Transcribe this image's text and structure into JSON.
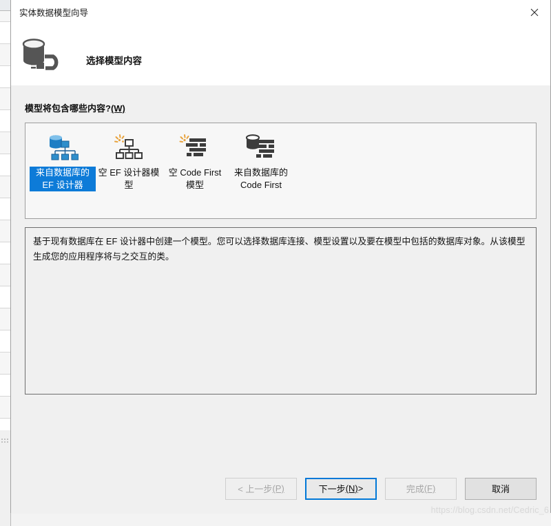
{
  "window": {
    "title": "实体数据模型向导",
    "close_icon": "close-icon",
    "header_icon": "database-plug-icon",
    "header_title": "选择模型内容"
  },
  "body": {
    "question_text": "模型将包含哪些内容?",
    "question_accel": "(W)"
  },
  "templates": {
    "items": [
      {
        "label": "来自数据库的 EF 设计器",
        "icon": "database-designer-icon",
        "selected": true
      },
      {
        "label": "空 EF 设计器模型",
        "icon": "empty-designer-icon",
        "selected": false
      },
      {
        "label": "空 Code First 模型",
        "icon": "empty-code-first-icon",
        "selected": false
      },
      {
        "label": "来自数据库的 Code First",
        "icon": "database-code-first-icon",
        "selected": false
      }
    ]
  },
  "description": {
    "text": "基于现有数据库在 EF 设计器中创建一个模型。您可以选择数据库连接、模型设置以及要在模型中包括的数据库对象。从该模型生成您的应用程序将与之交互的类。"
  },
  "footer": {
    "buttons": [
      {
        "name": "back-button",
        "text": "< 上一步",
        "accel": "(P)",
        "suffix": "",
        "state": "disabled"
      },
      {
        "name": "next-button",
        "text": "下一步",
        "accel": "(N)",
        "suffix": " >",
        "state": "default"
      },
      {
        "name": "finish-button",
        "text": "完成",
        "accel": "(F)",
        "suffix": "",
        "state": "disabled"
      },
      {
        "name": "cancel-button",
        "text": "取消",
        "accel": "",
        "suffix": "",
        "state": "normal"
      }
    ]
  },
  "watermark": {
    "text": "https://blog.csdn.net/Cedric_6"
  },
  "colors": {
    "selection_blue": "#0d7bd8",
    "default_button_border": "#0078d7",
    "icon_blue": "#1f7ec4",
    "icon_dark": "#3c3c3c",
    "icon_orange": "#e8a33d"
  }
}
